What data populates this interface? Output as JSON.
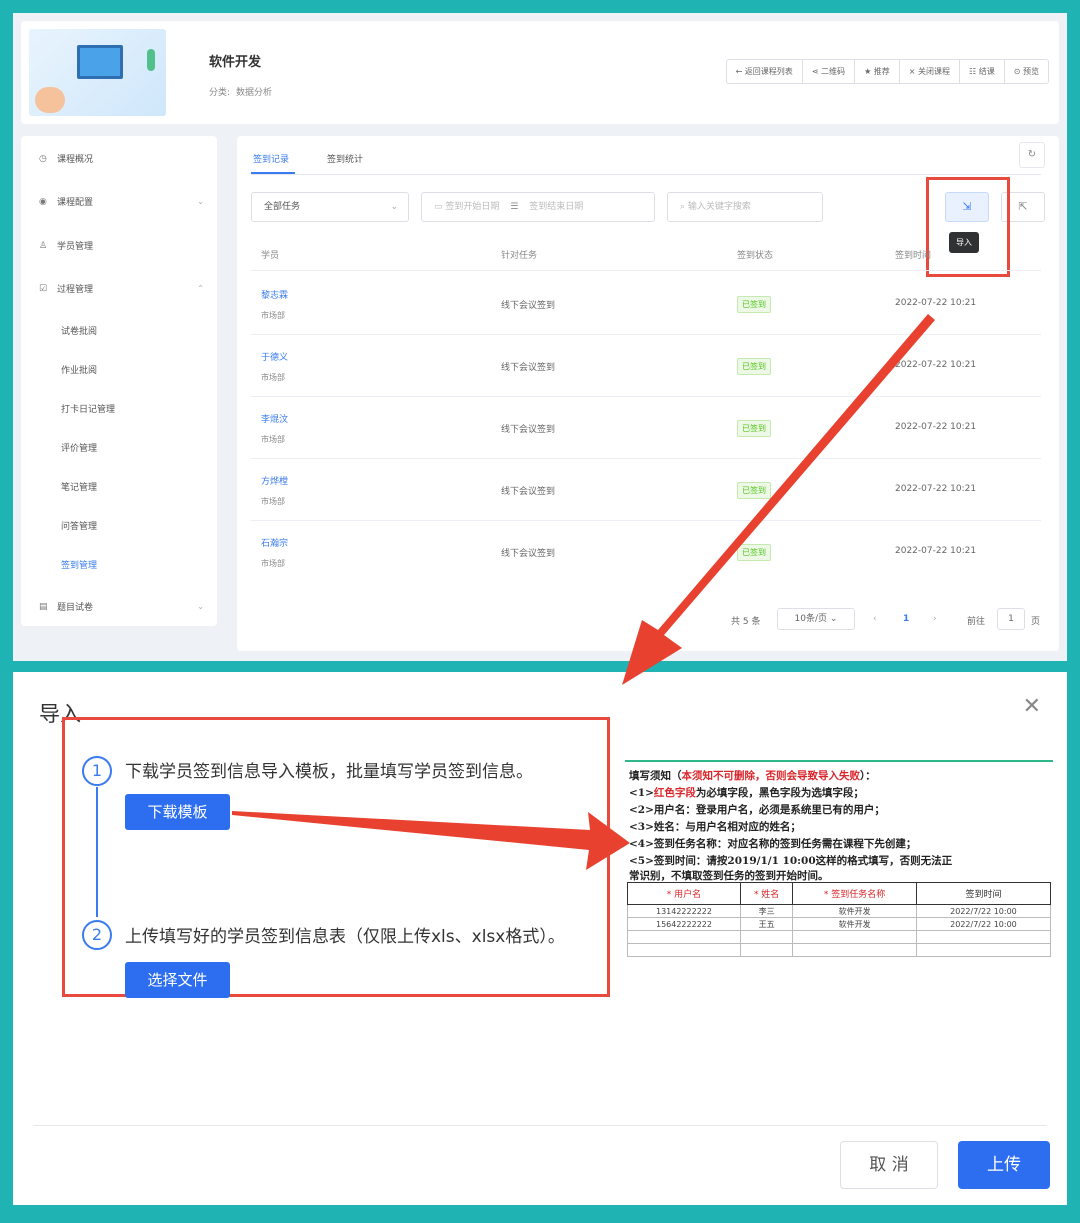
{
  "course": {
    "title": "软件开发",
    "category_label": "分类:",
    "category_value": "数据分析",
    "actions": [
      "← 返回课程列表",
      "⋖ 二维码",
      "★ 推荐",
      "× 关闭课程",
      "☷ 结课",
      "⊙ 预览"
    ]
  },
  "sidebar": {
    "items": [
      {
        "icon": "◷",
        "label": "课程概况"
      },
      {
        "icon": "◉",
        "label": "课程配置"
      },
      {
        "icon": "♙",
        "label": "学员管理"
      },
      {
        "icon": "☑",
        "label": "过程管理"
      }
    ],
    "sub_items": [
      "试卷批阅",
      "作业批阅",
      "打卡日记管理",
      "评价管理",
      "笔记管理",
      "问答管理",
      "签到管理"
    ],
    "last_item": {
      "icon": "▤",
      "label": "题目试卷"
    }
  },
  "tabs": [
    "签到记录",
    "签到统计"
  ],
  "filters": {
    "task": "全部任务",
    "date_start": "签到开始日期",
    "date_end": "签到结束日期",
    "search": "输入关键字搜索"
  },
  "tooltip": "导入",
  "table": {
    "headers": [
      "学员",
      "针对任务",
      "签到状态",
      "签到时间"
    ],
    "rows": [
      {
        "name": "黎志霖",
        "dept": "市场部",
        "task": "线下会议签到",
        "status": "已签到",
        "time": "2022-07-22 10:21"
      },
      {
        "name": "于德义",
        "dept": "市场部",
        "task": "线下会议签到",
        "status": "已签到",
        "time": "2022-07-22 10:21"
      },
      {
        "name": "李焜汶",
        "dept": "市场部",
        "task": "线下会议签到",
        "status": "已签到",
        "time": "2022-07-22 10:21"
      },
      {
        "name": "方烨樘",
        "dept": "市场部",
        "task": "线下会议签到",
        "status": "已签到",
        "time": "2022-07-22 10:21"
      },
      {
        "name": "石瀚宗",
        "dept": "市场部",
        "task": "线下会议签到",
        "status": "已签到",
        "time": "2022-07-22 10:21"
      }
    ]
  },
  "pagination": {
    "total": "共 5 条",
    "page_size": "10条/页",
    "current_page": "1",
    "goto_label": "前往",
    "goto_value": "1",
    "page_suffix": "页"
  },
  "dialog": {
    "title": "导入",
    "step1_num": "1",
    "step1_text": "下载学员签到信息导入模板，批量填写学员签到信息。",
    "download_btn": "下载模板",
    "step2_num": "2",
    "step2_text": "上传填写好的学员签到信息表（仅限上传xls、xlsx格式）。",
    "select_btn": "选择文件",
    "cancel_btn": "取 消",
    "upload_btn": "上传"
  },
  "template": {
    "notice_head": "填写须知（",
    "notice_red": "本须知不可删除，否则会导致导入失败",
    "notice_tail": "）：",
    "rule1_pre": "<1>",
    "rule1_red": "红色字段",
    "rule1_tail": "为必填字段，黑色字段为选填字段；",
    "rule2": "<2>用户名：登录用户名，必须是系统里已有的用户；",
    "rule3": "<3>姓名：与用户名相对应的姓名；",
    "rule4": "<4>签到任务名称：对应名称的签到任务需在课程下先创建；",
    "rule5a": "<5>签到时间：请按2019/1/1 10:00这样的格式填写，否则无法正",
    "rule5b": "常识别，不填取签到任务的签到开始时间。",
    "headers": [
      "* 用户名",
      "* 姓名",
      "* 签到任务名称",
      "签到时间"
    ],
    "rows": [
      [
        "13142222222",
        "李三",
        "软件开发",
        "2022/7/22 10:00"
      ],
      [
        "15642222222",
        "王五",
        "软件开发",
        "2022/7/22 10:00"
      ]
    ]
  },
  "colors": {
    "accent": "#3a7bf0",
    "highlight_red": "#e84a3d",
    "frame": "#1fb3b3",
    "success": "#52c41a"
  }
}
